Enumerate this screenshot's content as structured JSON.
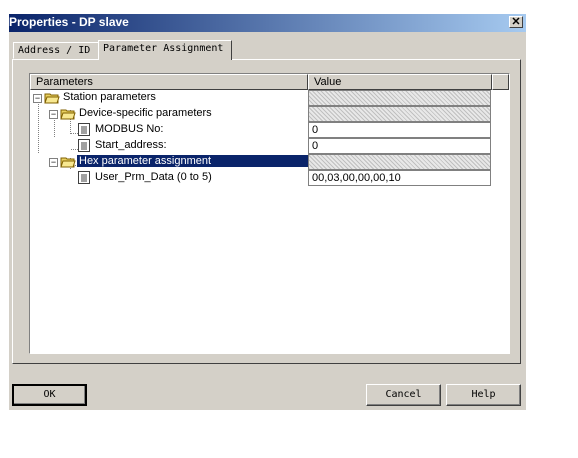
{
  "window": {
    "title": "Properties - DP slave",
    "close_symbol": "✕"
  },
  "tabs": [
    {
      "label": "Address / ID"
    },
    {
      "label": "Parameter Assignment"
    }
  ],
  "table": {
    "columns": [
      "Parameters",
      "Value"
    ],
    "rows": [
      {
        "label": "Station parameters",
        "value": ""
      },
      {
        "label": "Device-specific parameters",
        "value": ""
      },
      {
        "label": "MODBUS No:",
        "value": "0"
      },
      {
        "label": "Start_address:",
        "value": "0"
      },
      {
        "label": "Hex parameter assignment",
        "value": ""
      },
      {
        "label": "User_Prm_Data (0 to 5)",
        "value": "00,03,00,00,00,10"
      }
    ]
  },
  "buttons": {
    "ok": "OK",
    "cancel": "Cancel",
    "help": "Help"
  },
  "colors": {
    "title_start": "#0a246a",
    "selection": "#0a246a",
    "face": "#d4d0c8"
  }
}
